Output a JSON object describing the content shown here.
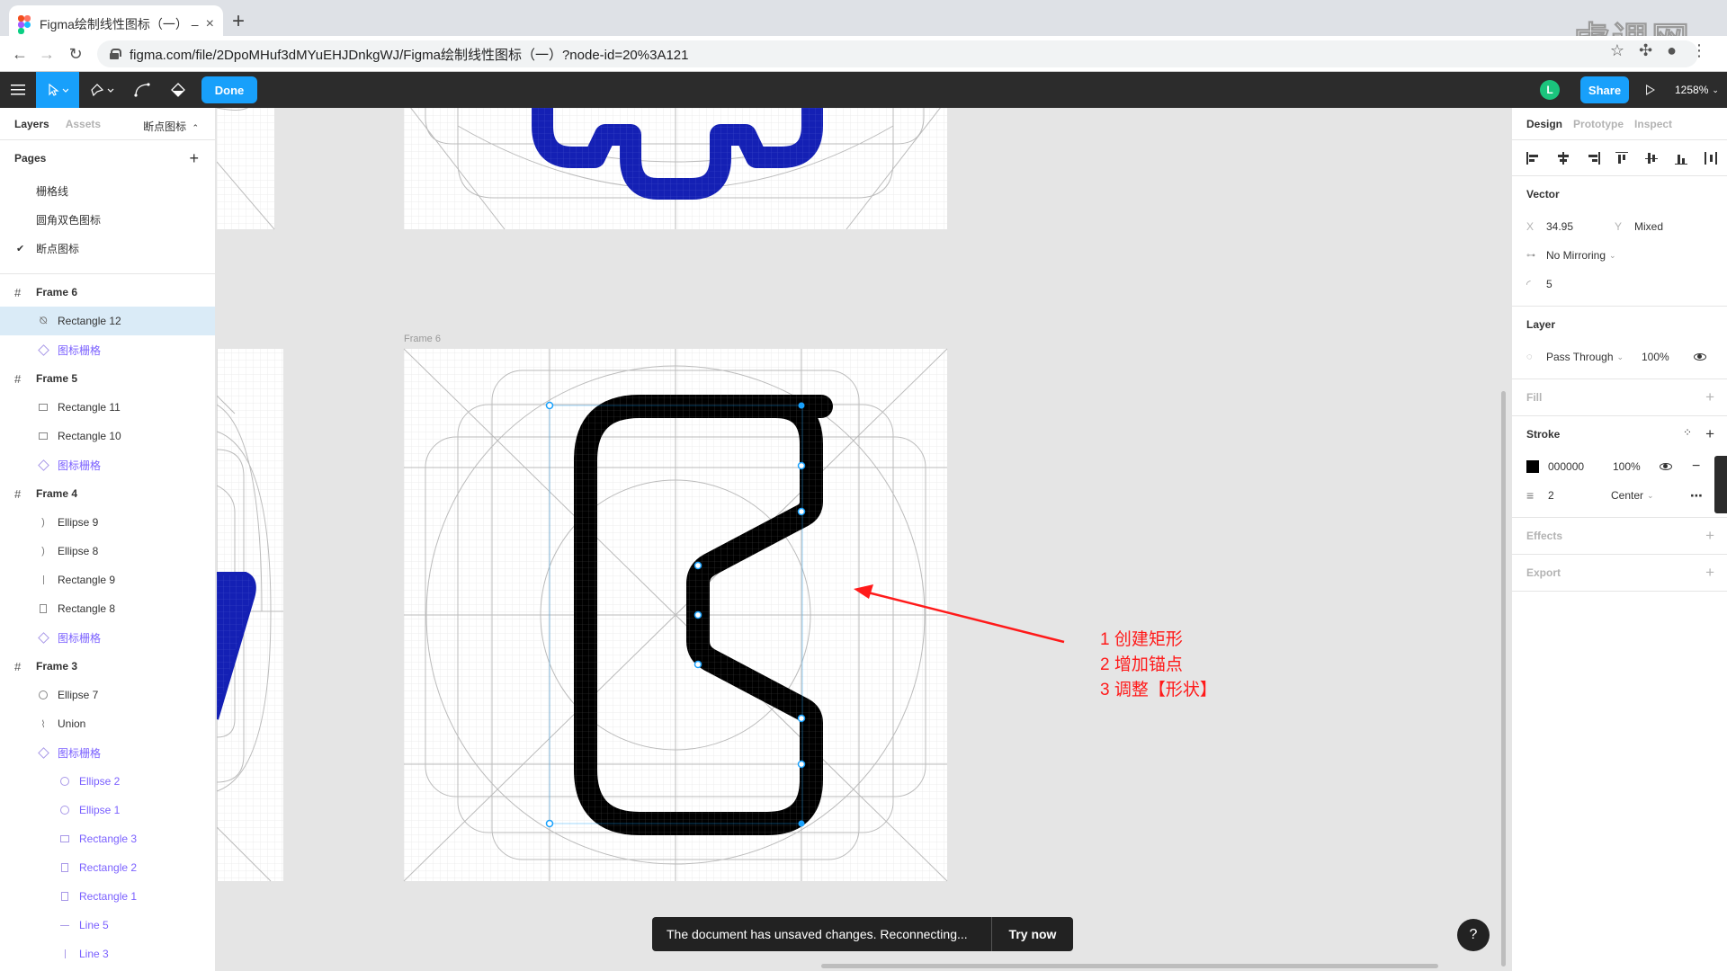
{
  "browser": {
    "tab_title": "Figma绘制线性图标（一） – Fig",
    "tab_close": "×",
    "new_tab": "+",
    "url": "figma.com/file/2DpoMHuf3dMYuEHJDnkgWJ/Figma绘制线性图标（一）?node-id=20%3A121",
    "watermark": "虎课网"
  },
  "toolbar": {
    "done_label": "Done",
    "avatar_initial": "L",
    "share_label": "Share",
    "zoom": "1258%"
  },
  "left_panel": {
    "tabs": [
      "Layers",
      "Assets"
    ],
    "current_page_select": "断点图标",
    "pages_header": "Pages",
    "pages": [
      {
        "label": "栅格线",
        "current": false
      },
      {
        "label": "圆角双色图标",
        "current": false
      },
      {
        "label": "断点图标",
        "current": true
      }
    ],
    "layers": [
      {
        "label": "Frame 6",
        "kind": "frame"
      },
      {
        "label": "Rectangle 12",
        "kind": "vector",
        "selected": true
      },
      {
        "label": "图标栅格",
        "kind": "component"
      },
      {
        "label": "Frame 5",
        "kind": "frame"
      },
      {
        "label": "Rectangle 11",
        "kind": "rect"
      },
      {
        "label": "Rectangle 10",
        "kind": "rect"
      },
      {
        "label": "图标栅格",
        "kind": "component"
      },
      {
        "label": "Frame 4",
        "kind": "frame"
      },
      {
        "label": "Ellipse 9",
        "kind": "paren"
      },
      {
        "label": "Ellipse 8",
        "kind": "paren"
      },
      {
        "label": "Rectangle 9",
        "kind": "line"
      },
      {
        "label": "Rectangle 8",
        "kind": "rect-v"
      },
      {
        "label": "图标栅格",
        "kind": "component"
      },
      {
        "label": "Frame 3",
        "kind": "frame"
      },
      {
        "label": "Ellipse 7",
        "kind": "ellipse"
      },
      {
        "label": "Union",
        "kind": "union"
      },
      {
        "label": "图标栅格",
        "kind": "component"
      },
      {
        "label": "Ellipse 2",
        "kind": "g-ellipse"
      },
      {
        "label": "Ellipse 1",
        "kind": "g-ellipse"
      },
      {
        "label": "Rectangle 3",
        "kind": "g-rect"
      },
      {
        "label": "Rectangle 2",
        "kind": "g-rect-v"
      },
      {
        "label": "Rectangle 1",
        "kind": "g-rect-v"
      },
      {
        "label": "Line 5",
        "kind": "g-line"
      },
      {
        "label": "Line 3",
        "kind": "g-line-v"
      }
    ]
  },
  "canvas": {
    "frame_label": "Frame 6",
    "annotation_lines": [
      "1 创建矩形",
      "2 增加锚点",
      "3 调整【形状】"
    ],
    "accent_colors": {
      "icon_blue": "#1420b4",
      "selection": "#18a0fb",
      "arrow": "#ff1a1a"
    }
  },
  "toast": {
    "message": "The document has unsaved changes. Reconnecting...",
    "action": "Try now"
  },
  "help_label": "?",
  "right_panel": {
    "tabs": [
      "Design",
      "Prototype",
      "Inspect"
    ],
    "vector": {
      "title": "Vector",
      "x_label": "X",
      "x_value": "34.95",
      "y_label": "Y",
      "y_value": "Mixed",
      "mirroring": "No Mirroring",
      "corner_radius": "5"
    },
    "layer": {
      "title": "Layer",
      "blend_mode": "Pass Through",
      "opacity": "100%"
    },
    "fill_title": "Fill",
    "stroke": {
      "title": "Stroke",
      "color_hex": "000000",
      "opacity": "100%",
      "weight": "2",
      "position": "Center"
    },
    "effects_title": "Effects",
    "export_title": "Export"
  }
}
